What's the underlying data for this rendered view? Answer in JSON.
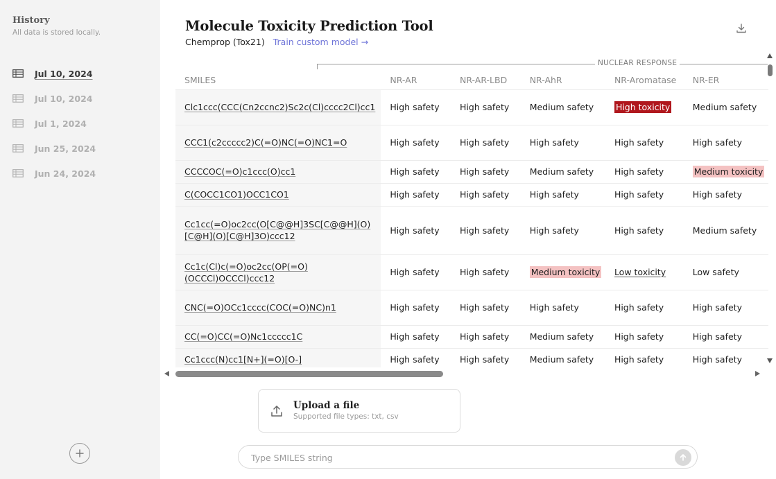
{
  "sidebar": {
    "title": "History",
    "subtitle": "All data is stored locally.",
    "items": [
      {
        "label": "Jul 10, 2024",
        "active": true
      },
      {
        "label": "Jul 10, 2024",
        "active": false
      },
      {
        "label": "Jul 1, 2024",
        "active": false
      },
      {
        "label": "Jun 25, 2024",
        "active": false
      },
      {
        "label": "Jun 24, 2024",
        "active": false
      }
    ],
    "add_icon": "plus-icon",
    "item_icon": "table-icon"
  },
  "header": {
    "title": "Molecule Toxicity Prediction Tool",
    "model": "Chemprop (Tox21)",
    "train_link": "Train custom model",
    "train_link_arrow": "→",
    "download_icon": "download-icon"
  },
  "table": {
    "group_label": "NUCLEAR RESPONSE",
    "columns": [
      "SMILES",
      "NR-AR",
      "NR-AR-LBD",
      "NR-AhR",
      "NR-Aromatase",
      "NR-ER"
    ],
    "rows": [
      {
        "smiles": "Clc1ccc(CCC(Cn2ccnc2)Sc2c(Cl)cccc2Cl)cc1",
        "values": [
          "High safety",
          "High safety",
          "Medium safety",
          "High toxicity",
          "Medium safety"
        ]
      },
      {
        "smiles": "CCC1(c2ccccc2)C(=O)NC(=O)NC1=O",
        "values": [
          "High safety",
          "High safety",
          "High safety",
          "High safety",
          "High safety"
        ]
      },
      {
        "smiles": "CCCCOC(=O)c1ccc(O)cc1",
        "values": [
          "High safety",
          "High safety",
          "Medium safety",
          "High safety",
          "Medium toxicity"
        ]
      },
      {
        "smiles": "C(COCC1CO1)OCC1CO1",
        "values": [
          "High safety",
          "High safety",
          "High safety",
          "High safety",
          "High safety"
        ]
      },
      {
        "smiles": "Cc1cc(=O)oc2cc(O[C@@H]3SC[C@@H](O)[C@H](O)[C@H]3O)ccc12",
        "values": [
          "High safety",
          "High safety",
          "High safety",
          "High safety",
          "Medium safety"
        ]
      },
      {
        "smiles": "Cc1c(Cl)c(=O)oc2cc(OP(=O)(OCCCl)OCCCl)ccc12",
        "values": [
          "High safety",
          "High safety",
          "Medium toxicity",
          "Low toxicity",
          "Low safety"
        ]
      },
      {
        "smiles": "CNC(=O)OCc1cccc(COC(=O)NC)n1",
        "values": [
          "High safety",
          "High safety",
          "High safety",
          "High safety",
          "High safety"
        ]
      },
      {
        "smiles": "CC(=O)CC(=O)Nc1ccccc1C",
        "values": [
          "High safety",
          "High safety",
          "Medium safety",
          "High safety",
          "High safety"
        ]
      },
      {
        "smiles": "Cc1ccc(N)cc1[N+](=O)[O-]",
        "values": [
          "High safety",
          "High safety",
          "Medium safety",
          "High safety",
          "High safety"
        ]
      }
    ],
    "colors": {
      "high_toxicity": "#b0171d",
      "medium_toxicity": "#f4c2c2"
    }
  },
  "upload": {
    "title": "Upload a file",
    "subtitle": "Supported file types: txt, csv",
    "icon": "upload-icon"
  },
  "input": {
    "placeholder": "Type SMILES string",
    "send_icon": "arrow-up-icon"
  }
}
